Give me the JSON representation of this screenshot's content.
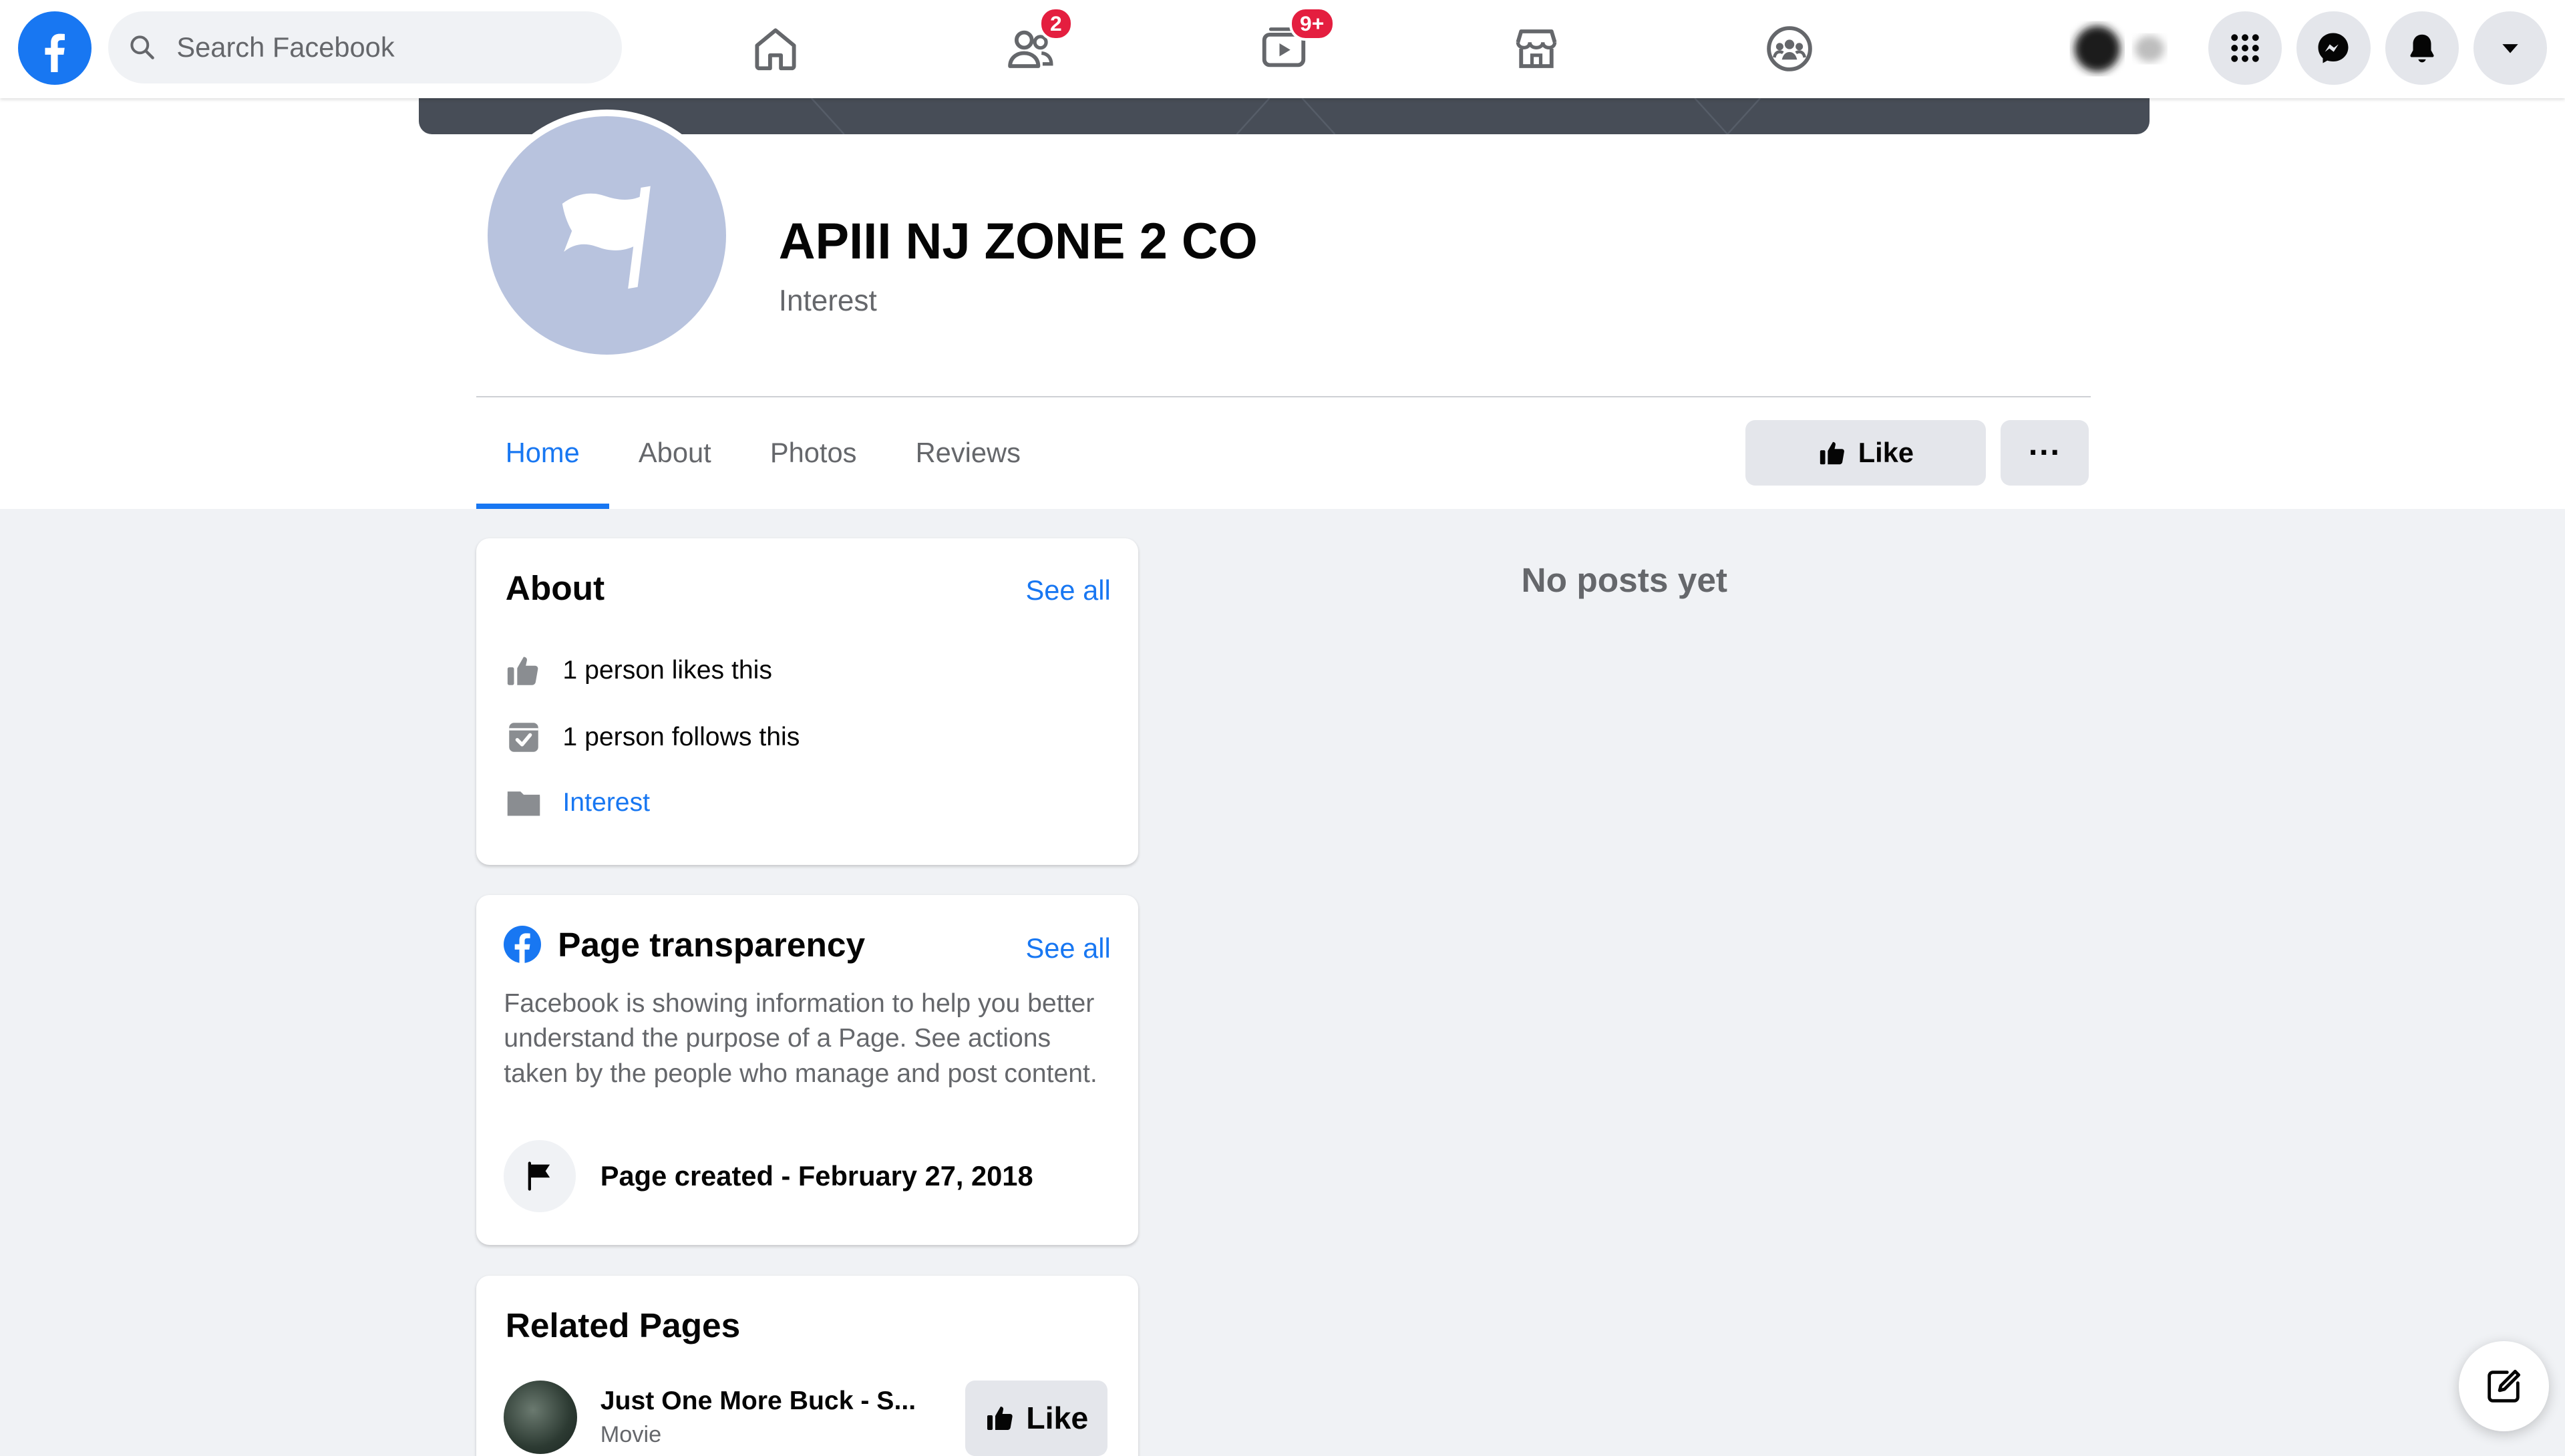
{
  "colors": {
    "brand_blue": "#1877f2",
    "badge_red": "#e41e3f",
    "background": "#f0f2f5",
    "avatar_placeholder": "#b8c3de"
  },
  "topbar": {
    "logo_icon": "facebook-logo-icon",
    "search": {
      "placeholder": "Search Facebook",
      "icon": "search-icon"
    },
    "nav": {
      "home_icon": "home-icon",
      "friends_icon": "friends-icon",
      "friends_badge": "2",
      "watch_icon": "watch-icon",
      "watch_badge": "9+",
      "marketplace_icon": "marketplace-icon",
      "groups_icon": "groups-icon"
    },
    "right": {
      "menu_icon": "grid-menu-icon",
      "messenger_icon": "messenger-icon",
      "notifications_icon": "bell-icon",
      "account_icon": "chevron-down-icon"
    }
  },
  "page": {
    "name": "APIII NJ ZONE 2 CO",
    "category": "Interest",
    "tabs": [
      {
        "label": "Home",
        "active": true
      },
      {
        "label": "About",
        "active": false
      },
      {
        "label": "Photos",
        "active": false
      },
      {
        "label": "Reviews",
        "active": false
      }
    ],
    "like_label": "Like",
    "more_label": "···"
  },
  "about_card": {
    "title": "About",
    "see_all": "See all",
    "likes": "1 person likes this",
    "follows": "1 person follows this",
    "category": "Interest"
  },
  "transparency_card": {
    "title": "Page transparency",
    "see_all": "See all",
    "description": "Facebook is showing information to help you better understand the purpose of a Page. See actions taken by the people who manage and post content.",
    "created": "Page created - February 27, 2018"
  },
  "related_card": {
    "title": "Related Pages",
    "items": [
      {
        "name": "Just One More Buck - S...",
        "category": "Movie",
        "like_label": "Like"
      }
    ]
  },
  "feed": {
    "empty_message": "No posts yet"
  }
}
